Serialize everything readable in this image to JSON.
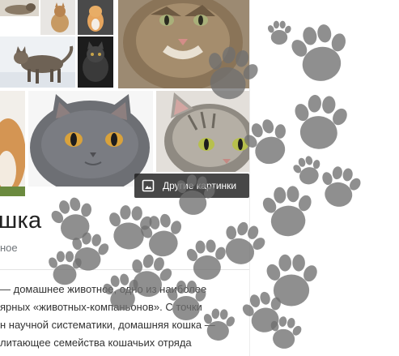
{
  "images": {
    "row1": [
      "cat-tile-1",
      "cat-tile-2",
      "cat-tile-3",
      "cat-tile-4",
      "cat-tile-5",
      "cat-tile-6"
    ],
    "row2": [
      "cat-tile-7",
      "cat-tile-8",
      "cat-tile-9"
    ]
  },
  "more_images_button": {
    "label": "Другие картинки",
    "icon": "image-icon"
  },
  "knowledge_panel": {
    "title": "шка",
    "subtitle": "ное",
    "description_lines": [
      "— домашнее животное, одно из наиболее",
      "ярных «животных-компаньонов». С точки",
      "н научной систематики, домашняя кошка —",
      "литающее семейства кошачьих отряда"
    ]
  },
  "overlay": {
    "type": "paw-prints",
    "color": "#6f6f6f"
  }
}
